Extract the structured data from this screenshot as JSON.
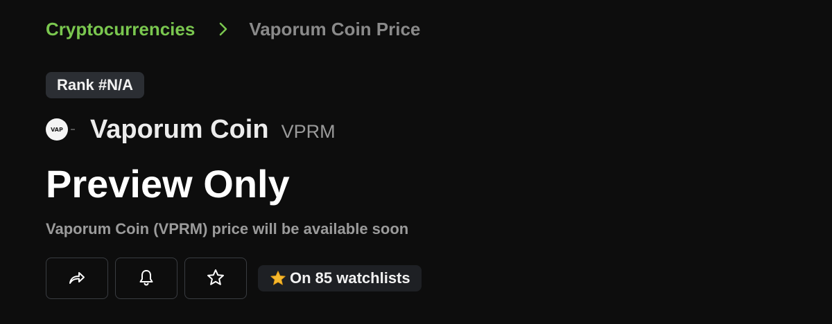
{
  "breadcrumb": {
    "parent": "Cryptocurrencies",
    "current": "Vaporum Coin Price",
    "separator_icon": "chevron-right-icon"
  },
  "rank": {
    "label": "Rank #N/A"
  },
  "coin": {
    "logo_text": "VAP",
    "name": "Vaporum Coin",
    "symbol": "VPRM"
  },
  "price": {
    "headline": "Preview Only",
    "subtitle": "Vaporum Coin (VPRM) price will be available soon"
  },
  "actions": [
    {
      "name": "share-button",
      "icon": "share-arrow-icon"
    },
    {
      "name": "alert-button",
      "icon": "bell-icon"
    },
    {
      "name": "watchlist-button",
      "icon": "star-outline-icon"
    }
  ],
  "watchlists": {
    "label": "On 85 watchlists",
    "icon": "star-filled-icon"
  },
  "colors": {
    "background": "#0d0d0d",
    "accent_green": "#7ac74f",
    "badge_bg": "#2b2e33",
    "star_yellow": "#f5b82e"
  }
}
